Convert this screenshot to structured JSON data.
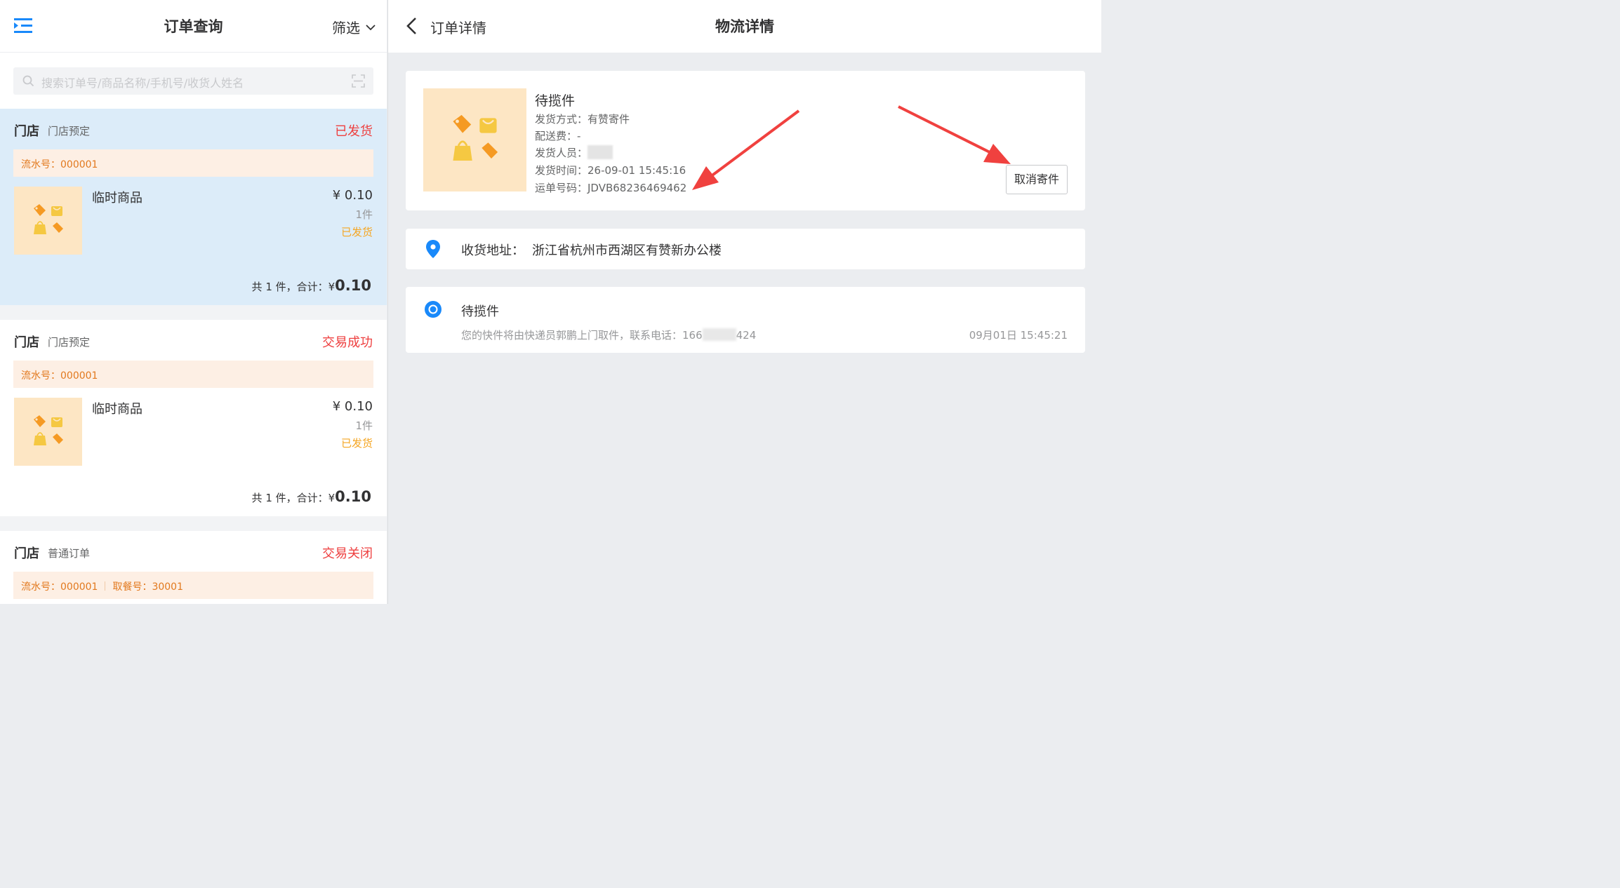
{
  "left_header": {
    "title": "订单查询",
    "filter_label": "筛选"
  },
  "search": {
    "placeholder": "搜索订单号/商品名称/手机号/收货人姓名"
  },
  "orders": [
    {
      "store": "门店",
      "type": "门店预定",
      "status": "已发货",
      "serial": "流水号：000001",
      "product_name": "临时商品",
      "price": "¥ 0.10",
      "qty": "1件",
      "ship_status": "已发货",
      "total_prefix": "共 1 件，合计：¥",
      "total_amount": "0.10"
    },
    {
      "store": "门店",
      "type": "门店预定",
      "status": "交易成功",
      "serial": "流水号：000001",
      "product_name": "临时商品",
      "price": "¥ 0.10",
      "qty": "1件",
      "ship_status": "已发货",
      "total_prefix": "共 1 件，合计：¥",
      "total_amount": "0.10"
    },
    {
      "store": "门店",
      "type": "普通订单",
      "status": "交易关闭",
      "serial": "流水号：000001",
      "pickup": "取餐号：30001"
    }
  ],
  "right_header": {
    "back_label": "订单详情",
    "title": "物流详情"
  },
  "shipment": {
    "title": "待揽件",
    "method": "发货方式：有赞寄件",
    "fee": "配送费：-",
    "staff_label": "发货人员：",
    "time": "发货时间：26-09-01 15:45:16",
    "waybill": "运单号码：JDVB68236469462",
    "cancel_label": "取消寄件"
  },
  "address": {
    "label": "收货地址：",
    "value": "浙江省杭州市西湖区有赞新办公楼"
  },
  "tracking": {
    "title": "待揽件",
    "desc_prefix": "您的快件将由快递员郭鹏上门取件，联系电话：166",
    "desc_suffix": "424",
    "time": "09月01日 15:45:21"
  },
  "colors": {
    "accent_blue": "#1989fa",
    "status_red": "#ee3f3f",
    "ship_orange": "#f5a623",
    "serial_bg": "#fdefe4",
    "active_row_bg": "#dcecf9",
    "annotation_arrow": "#f0413f"
  }
}
